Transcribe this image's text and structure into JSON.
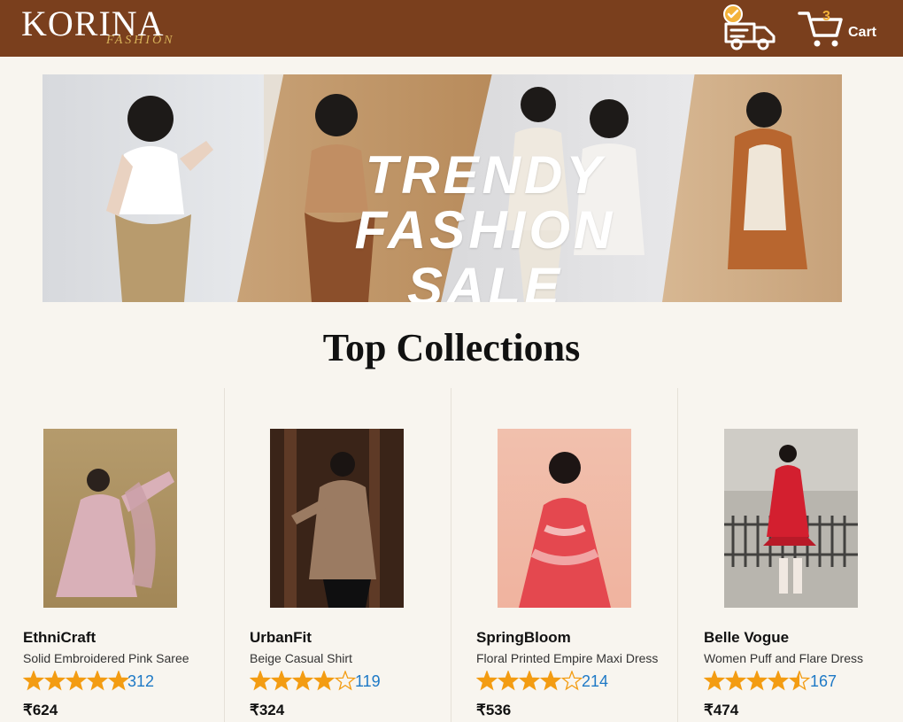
{
  "header": {
    "logo_main": "KORINA",
    "logo_sub": "FASHION",
    "icons": {
      "delivery": "truck-delivery-icon",
      "cart": "cart-icon"
    },
    "cart_count": "3",
    "cart_label": "Cart"
  },
  "banner": {
    "headline_line1": "TRENDY",
    "headline_line2": "FASHION SALE"
  },
  "section": {
    "title": "Top Collections"
  },
  "products": [
    {
      "brand": "EthniCraft",
      "description": "Solid Embroidered Pink Saree",
      "rating": 5.0,
      "rating_count": "312",
      "price": "₹624",
      "image": "pink-saree-photo"
    },
    {
      "brand": "UrbanFit",
      "description": "Beige Casual Shirt",
      "rating": 4.0,
      "rating_count": "119",
      "price": "₹324",
      "image": "beige-shirt-photo"
    },
    {
      "brand": "SpringBloom",
      "description": "Floral Printed Empire Maxi Dress",
      "rating": 4.0,
      "rating_count": "214",
      "price": "₹536",
      "image": "floral-maxi-dress-photo"
    },
    {
      "brand": "Belle Vogue",
      "description": "Women Puff and Flare Dress",
      "rating": 4.5,
      "rating_count": "167",
      "price": "₹474",
      "image": "red-puff-dress-photo"
    }
  ],
  "colors": {
    "header_bg": "#7a3f1d",
    "page_bg": "#f8f5ef",
    "accent_gold": "#f3b23a",
    "rating_link": "#1e79c6",
    "star_fill": "#f39c12"
  }
}
